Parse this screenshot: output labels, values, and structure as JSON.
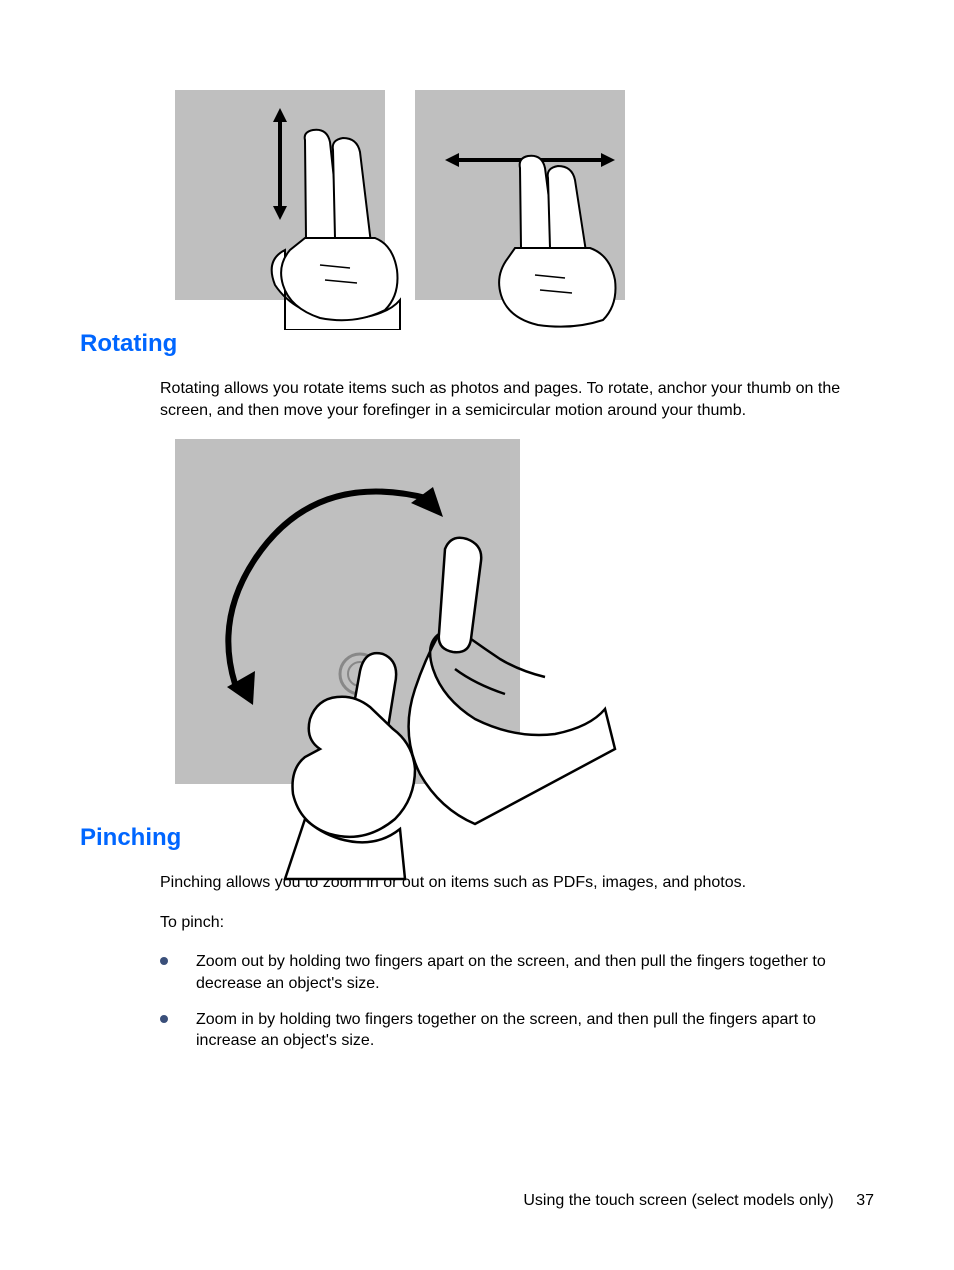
{
  "sections": {
    "rotating": {
      "heading": "Rotating",
      "body": "Rotating allows you rotate items such as photos and pages. To rotate, anchor your thumb on the screen, and then move your forefinger in a semicircular motion around your thumb."
    },
    "pinching": {
      "heading": "Pinching",
      "intro": "Pinching allows you to zoom in or out on items such as PDFs, images, and photos.",
      "lead": "To pinch:",
      "bullets": [
        "Zoom out by holding two fingers apart on the screen, and then pull the fingers together to decrease an object's size.",
        "Zoom in by holding two fingers together on the screen, and then pull the fingers apart to increase an object's size."
      ]
    }
  },
  "footer": {
    "section_title": "Using the touch screen (select models only)",
    "page_number": "37"
  }
}
